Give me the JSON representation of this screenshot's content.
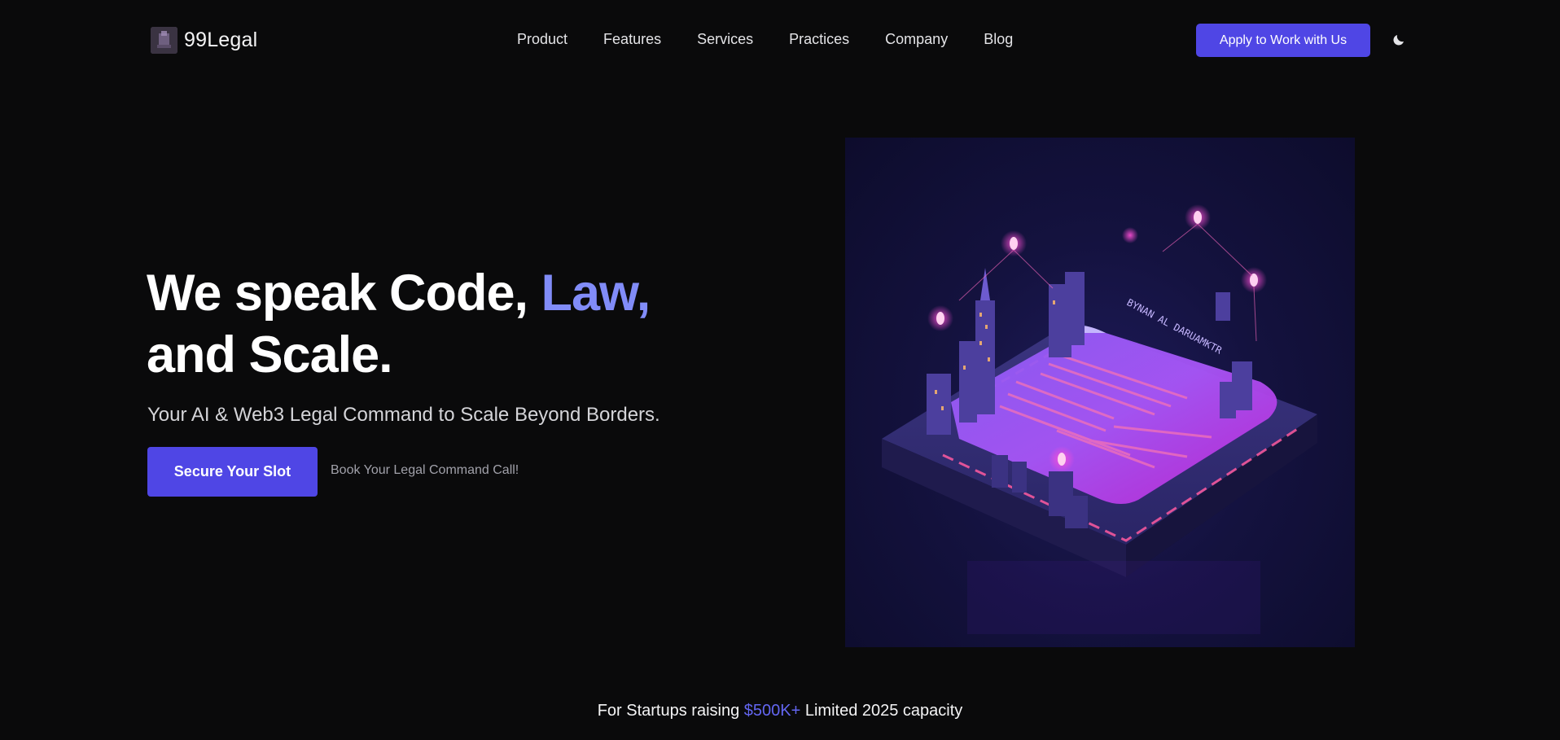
{
  "brand": {
    "name": "99Legal",
    "logo_icon": "brand-logo-icon"
  },
  "nav": {
    "items": [
      {
        "label": "Product"
      },
      {
        "label": "Features"
      },
      {
        "label": "Services"
      },
      {
        "label": "Practices"
      },
      {
        "label": "Company"
      },
      {
        "label": "Blog"
      }
    ]
  },
  "header": {
    "apply_label": "Apply to Work with Us",
    "theme_icon": "moon-icon"
  },
  "hero": {
    "title_line1_plain": "We speak Code, ",
    "title_line1_accent": "Law,",
    "title_line2": "and Scale.",
    "subtitle": "Your AI & Web3 Legal Command to Scale Beyond Borders.",
    "cta_primary": "Secure Your Slot",
    "cta_secondary": "Book Your Legal Command Call!",
    "illustration_text": "BYNAN AL DARUAMKTR"
  },
  "footer_note": {
    "before": "For Startups raising ",
    "amount": "$500K+",
    "after": " Limited 2025 capacity"
  },
  "colors": {
    "background": "#0a0a0b",
    "accent": "#4f46e5",
    "accent_text": "#818cf8"
  }
}
